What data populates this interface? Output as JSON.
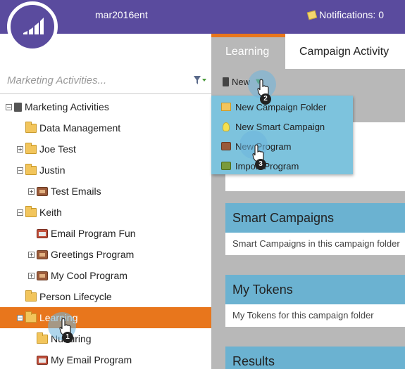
{
  "header": {
    "instance_name": "mar2016ent",
    "notifications": "Notifications: 0"
  },
  "search": {
    "placeholder": "Marketing Activities..."
  },
  "tree": [
    {
      "label": "Marketing Activities",
      "icon": "root-icon",
      "expander": "−",
      "indent": 0
    },
    {
      "label": "Data Management",
      "icon": "folder-icon",
      "expander": "",
      "indent": 1
    },
    {
      "label": "Joe Test",
      "icon": "folder-icon",
      "expander": "+",
      "indent": 1
    },
    {
      "label": "Justin",
      "icon": "folder-icon",
      "expander": "−",
      "indent": 1
    },
    {
      "label": "Test Emails",
      "icon": "program-icon",
      "expander": "+",
      "indent": 2
    },
    {
      "label": "Keith",
      "icon": "folder-icon",
      "expander": "−",
      "indent": 1
    },
    {
      "label": "Email Program Fun",
      "icon": "email-program-icon",
      "expander": "",
      "indent": 2
    },
    {
      "label": "Greetings Program",
      "icon": "program-icon",
      "expander": "+",
      "indent": 2
    },
    {
      "label": "My Cool Program",
      "icon": "program-icon",
      "expander": "+",
      "indent": 2
    },
    {
      "label": "Person Lifecycle",
      "icon": "folder-icon",
      "expander": "",
      "indent": 1
    },
    {
      "label": "Learning",
      "icon": "folder-icon",
      "expander": "−",
      "indent": 1,
      "selected": true
    },
    {
      "label": "Nurturing",
      "icon": "folder-icon",
      "expander": "",
      "indent": 2
    },
    {
      "label": "My Email Program",
      "icon": "email-program-icon",
      "expander": "",
      "indent": 2
    }
  ],
  "tabs": [
    "Learning",
    "Campaign Activity"
  ],
  "toolbar": {
    "new_label": "New"
  },
  "menu": [
    {
      "label": "New Campaign Folder",
      "icon": "folder-icon"
    },
    {
      "label": "New Smart Campaign",
      "icon": "lightbulb-icon"
    },
    {
      "label": "New Program",
      "icon": "program-icon"
    },
    {
      "label": "Import Program",
      "icon": "import-icon"
    }
  ],
  "panels": [
    {
      "title": "Smart Campaigns",
      "body": "Smart Campaigns in this campaign folder"
    },
    {
      "title": "My Tokens",
      "body": "My Tokens for this campaign folder"
    },
    {
      "title": "Results",
      "body": ""
    }
  ],
  "steps": [
    "1",
    "2",
    "3"
  ],
  "colors": {
    "header": "#5a4b9e",
    "selected": "#e8761c",
    "panel_header": "#6bb2d1",
    "menu": "#7dc3dd"
  }
}
